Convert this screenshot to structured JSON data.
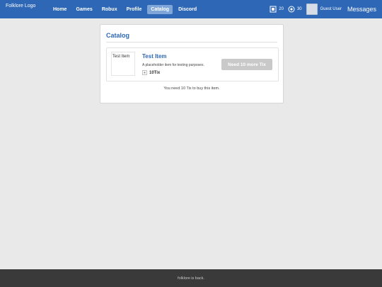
{
  "header": {
    "logo_alt": "Folklore Logo",
    "nav": [
      {
        "label": "Home",
        "active": false
      },
      {
        "label": "Games",
        "active": false
      },
      {
        "label": "Robux",
        "active": false
      },
      {
        "label": "Profile",
        "active": false
      },
      {
        "label": "Catalog",
        "active": true
      },
      {
        "label": "Discord",
        "active": false
      }
    ],
    "currency": [
      {
        "icon": "robux-icon",
        "value": "20"
      },
      {
        "icon": "tix-icon",
        "value": "30"
      }
    ],
    "username": "Guest User",
    "messages_label": "Messages"
  },
  "catalog": {
    "title": "Catalog",
    "item": {
      "thumbnail_alt": "Test Item",
      "name": "Test Item",
      "description": "A placeholder item for testing purposes.",
      "price": "10Tix",
      "button_label": "Need 10 more Tix"
    },
    "notice": "You need 10 Tix to buy this item."
  },
  "footer": {
    "text": "folklore is back."
  },
  "colors": {
    "header_bg": "#2d67b6",
    "active_nav": "#7ea6d8",
    "link": "#2d67b6",
    "disabled_button": "#c9c9c9",
    "footer_bg": "#3a3a3a",
    "page_bg": "#e9e9e9"
  }
}
